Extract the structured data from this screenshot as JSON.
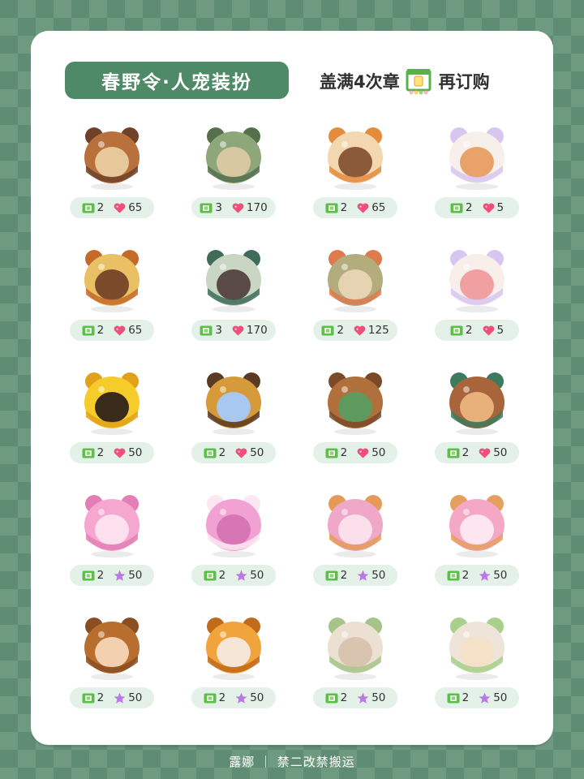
{
  "header": {
    "title": "春野令·人宠装扮",
    "notice_before": "盖满4次章",
    "notice_after": "再订购",
    "stamp_icon": "stamp-card-icon"
  },
  "colors": {
    "title_bg": "#4e8a67",
    "pill_bg": "#e3f1e9",
    "heart": "#f04f7c",
    "star": "#b97be0",
    "ticket": "#5dbf4a"
  },
  "items": [
    {
      "name": "bear-bucket-hat",
      "tickets": "2",
      "currency": "heart",
      "price": "65",
      "palette": [
        "#b8713c",
        "#6e4128",
        "#e7c89a"
      ]
    },
    {
      "name": "green-ranger-outfit",
      "tickets": "3",
      "currency": "heart",
      "price": "170",
      "palette": [
        "#8da77a",
        "#55704d",
        "#d8c8a2"
      ]
    },
    {
      "name": "bear-sneakers",
      "tickets": "2",
      "currency": "heart",
      "price": "65",
      "palette": [
        "#f3d7b0",
        "#e58b3c",
        "#8a5a3a"
      ]
    },
    {
      "name": "face-paint-paw",
      "tickets": "2",
      "currency": "heart",
      "price": "5",
      "palette": [
        "#f7efe9",
        "#d7c6f0",
        "#e9a36a"
      ]
    },
    {
      "name": "bear-bun-wig",
      "tickets": "2",
      "currency": "heart",
      "price": "65",
      "palette": [
        "#e9c064",
        "#c46a2a",
        "#7a4a2a"
      ]
    },
    {
      "name": "forest-vest-outfit",
      "tickets": "3",
      "currency": "heart",
      "price": "170",
      "palette": [
        "#c9d6c4",
        "#3e6b5a",
        "#5a4a45"
      ]
    },
    {
      "name": "bear-backpack",
      "tickets": "2",
      "currency": "heart",
      "price": "125",
      "palette": [
        "#b3ad7e",
        "#dd7a4e",
        "#e5d3b2"
      ]
    },
    {
      "name": "face-paint-blush",
      "tickets": "2",
      "currency": "heart",
      "price": "5",
      "palette": [
        "#f8eeea",
        "#d7c6f0",
        "#f0a0a0"
      ]
    },
    {
      "name": "yellow-bee-hood",
      "tickets": "2",
      "currency": "heart",
      "price": "50",
      "palette": [
        "#f6cc2a",
        "#e2a11a",
        "#3a2a1a"
      ]
    },
    {
      "name": "striped-bee-pet-hood",
      "tickets": "2",
      "currency": "heart",
      "price": "50",
      "palette": [
        "#d69a3a",
        "#5a3a22",
        "#a8c8f0"
      ]
    },
    {
      "name": "brown-bear-hood",
      "tickets": "2",
      "currency": "heart",
      "price": "50",
      "palette": [
        "#b0703c",
        "#7a4a28",
        "#5e9a5e"
      ]
    },
    {
      "name": "brown-bear-pet-hood",
      "tickets": "2",
      "currency": "heart",
      "price": "50",
      "palette": [
        "#a8643a",
        "#3e7a5e",
        "#e8b07a"
      ]
    },
    {
      "name": "pink-bee-hood",
      "tickets": "2",
      "currency": "star",
      "price": "50",
      "palette": [
        "#f5a7cf",
        "#e37fb5",
        "#fde0ee"
      ]
    },
    {
      "name": "pink-bunny-pet-hood",
      "tickets": "2",
      "currency": "star",
      "price": "50",
      "palette": [
        "#f2a2d2",
        "#fce6f2",
        "#d676b4"
      ]
    },
    {
      "name": "pink-bear-hood",
      "tickets": "2",
      "currency": "star",
      "price": "50",
      "palette": [
        "#f0a8c8",
        "#e59a5a",
        "#fbe0ec"
      ]
    },
    {
      "name": "pink-bear-pet-hood",
      "tickets": "2",
      "currency": "star",
      "price": "50",
      "palette": [
        "#f4a8c6",
        "#e5a060",
        "#fde6ef"
      ]
    },
    {
      "name": "brown-bee-hood",
      "tickets": "2",
      "currency": "star",
      "price": "50",
      "palette": [
        "#b86e2e",
        "#8a4e22",
        "#f2d0b0"
      ]
    },
    {
      "name": "orange-bunny-pet-hood",
      "tickets": "2",
      "currency": "star",
      "price": "50",
      "palette": [
        "#f2a43c",
        "#c06a1a",
        "#f6e6d8"
      ]
    },
    {
      "name": "cream-bear-hood",
      "tickets": "2",
      "currency": "star",
      "price": "50",
      "palette": [
        "#ece0d2",
        "#a6c48a",
        "#d9c4b0"
      ]
    },
    {
      "name": "cream-bear-pet-hood",
      "tickets": "2",
      "currency": "star",
      "price": "50",
      "palette": [
        "#efe4d8",
        "#a8d08a",
        "#f5e0c8"
      ]
    }
  ],
  "footer": {
    "text": "露娜 ｜ 禁二改禁搬运"
  }
}
